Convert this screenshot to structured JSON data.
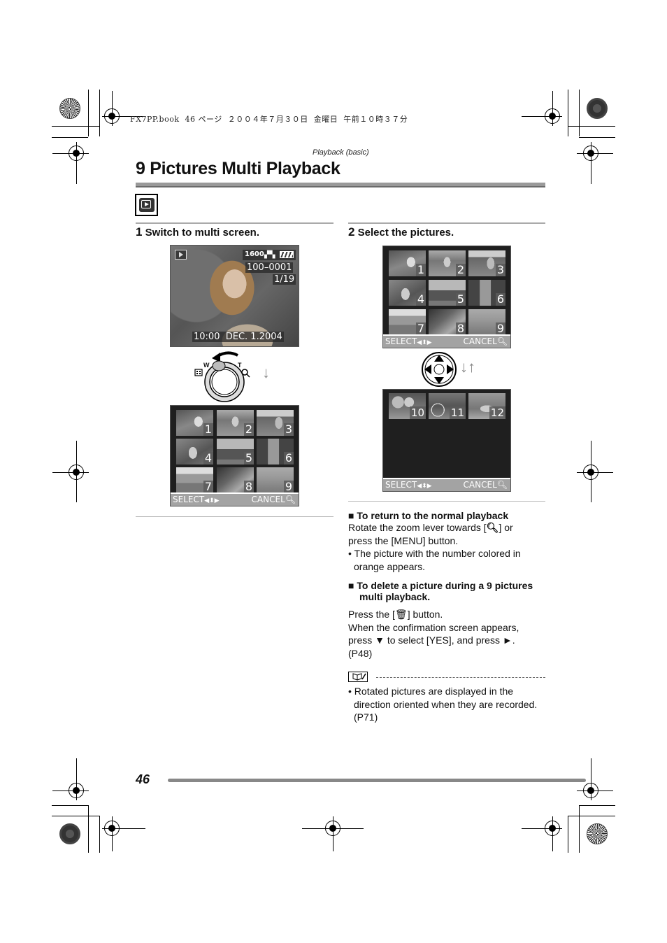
{
  "print_header": "FX7PP.book  46 ページ  ２００４年７月３０日  金曜日  午前１０時３７分",
  "section_label": "Playback (basic)",
  "title": "9 Pictures Multi Playback",
  "mode_icon": "playback-mode-icon",
  "step1": {
    "number": "1",
    "label": "Switch to multi screen.",
    "single_screen": {
      "iso": "1600",
      "folder_file": "100–0001",
      "counter": "1/19",
      "datetime": "10:00  DEC. 1.2004"
    },
    "zoom_lever": {
      "w_label": "W",
      "t_label": "T",
      "direction_arrow": "↓"
    },
    "multi_screen": {
      "thumbnails": [
        "1",
        "2",
        "3",
        "4",
        "5",
        "6",
        "7",
        "8",
        "9"
      ],
      "select_label": "SELECT",
      "cancel_label": "CANCEL"
    }
  },
  "step2": {
    "number": "2",
    "label": "Select the pictures.",
    "screen_a": {
      "thumbnails": [
        "1",
        "2",
        "3",
        "4",
        "5",
        "6",
        "7",
        "8",
        "9"
      ],
      "select_label": "SELECT",
      "cancel_label": "CANCEL"
    },
    "cursor_arrows": "↓↑",
    "screen_b": {
      "thumbnails": [
        "10",
        "11",
        "12"
      ],
      "select_label": "SELECT",
      "cancel_label": "CANCEL"
    }
  },
  "return_section": {
    "heading": "To return to the normal playback",
    "line1_pre": "Rotate the zoom lever towards [",
    "line1_post": "] or",
    "line2": "press the [MENU] button.",
    "bullet_line1": "The picture with the number colored in",
    "bullet_line2": "orange appears."
  },
  "delete_section": {
    "heading_line1": "To delete a picture during a 9 pictures",
    "heading_line2": "multi playback.",
    "line1_pre": "Press the [",
    "line1_post": "] button.",
    "line2": "When the confirmation screen appears,",
    "line3": "press ▼ to select [YES], and press ►.",
    "line4": "(P48)"
  },
  "note": {
    "bullet_line1": "Rotated pictures are displayed in the",
    "bullet_line2": "direction oriented when they are recorded.",
    "bullet_line3": "(P71)"
  },
  "page_number": "46"
}
